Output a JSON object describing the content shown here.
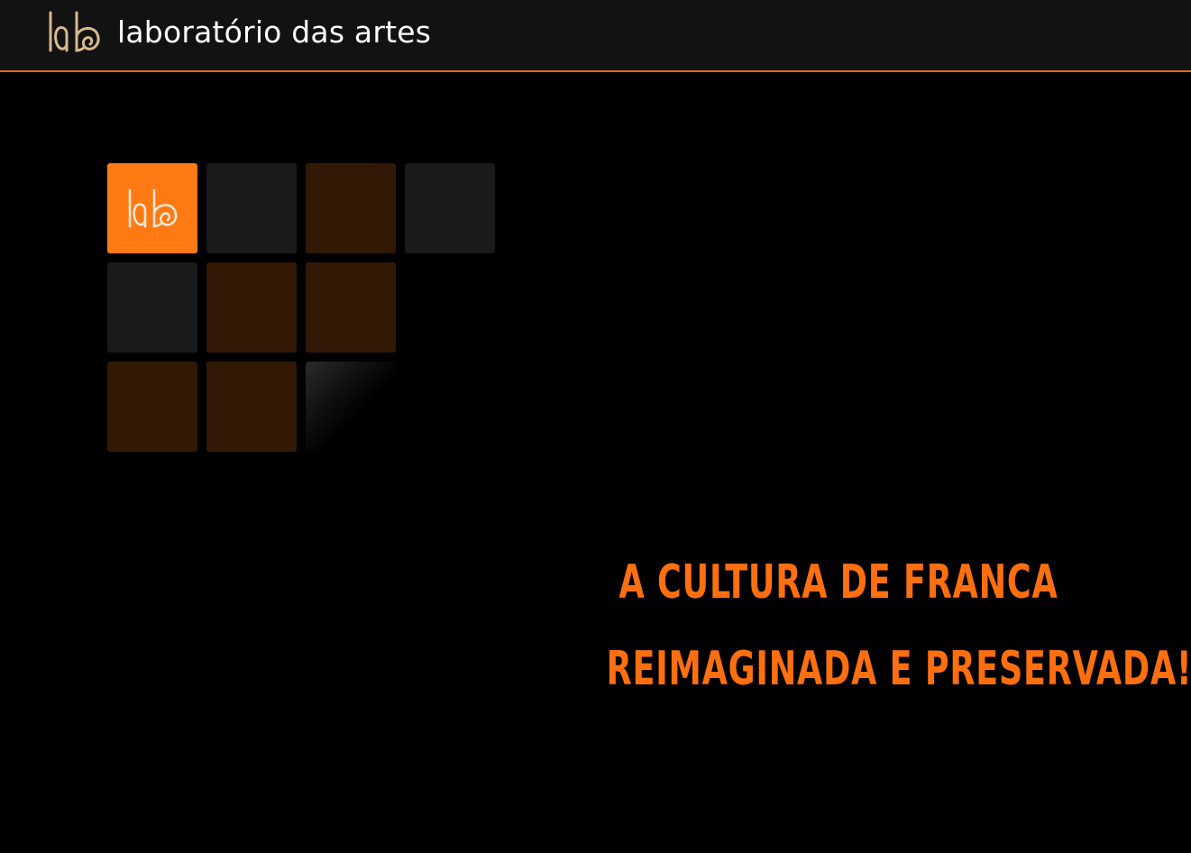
{
  "header": {
    "brand_name": "laboratório das artes",
    "logo_icon": "lab-logo-icon",
    "accent_border": "#e8691a"
  },
  "grid": {
    "tiles": [
      {
        "kind": "logo",
        "color": "#ff7a12",
        "icon": "lab-logo-icon"
      },
      {
        "kind": "plain",
        "color": "#1a1a1a"
      },
      {
        "kind": "plain",
        "color": "#321906"
      },
      {
        "kind": "plain",
        "color": "#1a1a1a"
      },
      {
        "kind": "plain",
        "color": "#1a1a1a"
      },
      {
        "kind": "plain",
        "color": "#321906"
      },
      {
        "kind": "plain",
        "color": "#321906"
      },
      {
        "kind": "plain",
        "color": "#321906"
      },
      {
        "kind": "plain",
        "color": "#321906"
      },
      {
        "kind": "fade",
        "color": "#2b2b2b"
      }
    ]
  },
  "hero": {
    "line1": "A Cultura de Franca",
    "line2": "Reimaginada e Preservada!",
    "color": "#ff6f10"
  }
}
